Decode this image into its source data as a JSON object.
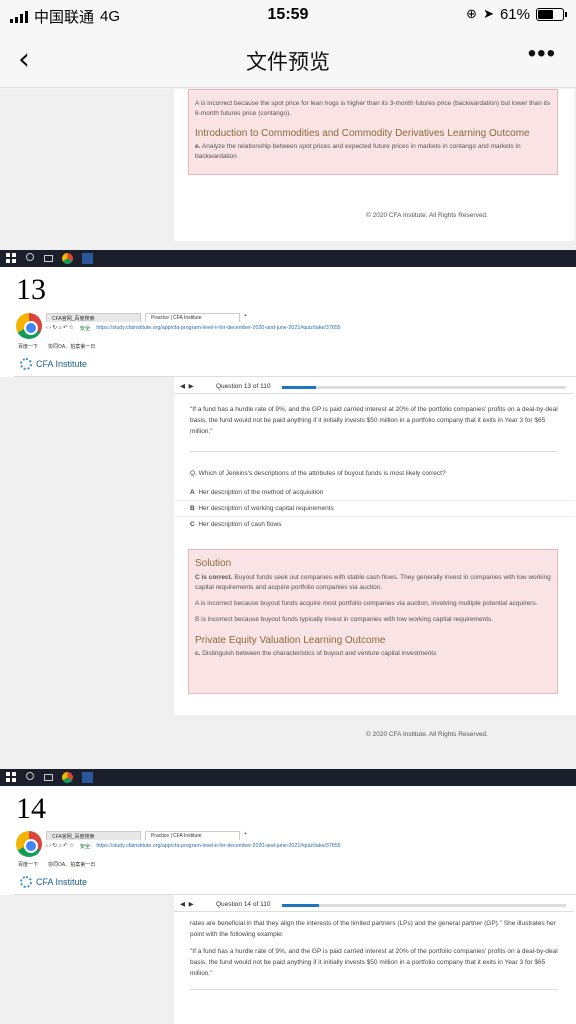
{
  "status": {
    "carrier": "中国联通",
    "network": "4G",
    "time": "15:59",
    "battery": "61%",
    "battery_level": 0.61
  },
  "nav": {
    "back_icon": "chevron-left",
    "title": "文件预览",
    "more_icon": "more-dots"
  },
  "prev_page": {
    "explanation_a": "A is incorrect because the spot price for lean hogs is higher than its 3-month futures price (backwardation) but lower than its 6-month futures price (contango).",
    "outcome_title": "Introduction to Commodities and Commodity Derivatives Learning Outcome",
    "outcome_letter": "e.",
    "outcome_text": "Analyze the relationship between spot prices and expected future prices in markets in contango and markets in backwardation",
    "footer": "© 2020 CFA Institute. All Rights Reserved."
  },
  "page13": {
    "number": "13",
    "tab1": "CFA官网_百度搜索",
    "tab2": "Practice | CFA Institute",
    "secure": "安全",
    "url": "https://study.cfainstitute.org/app/cfa-program-level-ii-for-december-2020-and-june-2021#quiz/take/37655",
    "bookmark1": "百度一下",
    "bookmark2": "协同OA、拍案第一日",
    "brand": "CFA Institute",
    "question_label": "Question 13 of 110",
    "progress": 0.12,
    "quote": "\"If a fund has a hurdle rate of 9%, and the GP is paid carried interest at 20% of the portfolio companies' profits on a deal-by-deal basis, the fund would not be paid anything if it initially invests $50 million in a portfolio company that it exits in Year 3 for $65 million.\"",
    "question": "Q. Which of Jenkins's descriptions of the attributes of buyout funds is most likely correct?",
    "options": [
      {
        "letter": "A",
        "text": "Her description of the method of acquisition"
      },
      {
        "letter": "B",
        "text": "Her description of working capital requirements"
      },
      {
        "letter": "C",
        "text": "Her description of cash flows"
      }
    ],
    "solution_title": "Solution",
    "solution_correct": "C is correct.",
    "solution_text": "Buyout funds seek out companies with stable cash flows. They generally invest in companies with low working capital requirements and acquire portfolio companies via auction.",
    "explanation_a": "A is incorrect because buyout funds acquire most portfolio companies via auction, involving multiple potential acquirers.",
    "explanation_b": "B is incorrect because buyout funds typically invest in companies with low working capital requirements.",
    "outcome_title": "Private Equity Valuation Learning Outcome",
    "outcome_letter": "c.",
    "outcome_text": "Distinguish between the characteristics of buyout and venture capital investments",
    "footer": "© 2020 CFA Institute. All Rights Reserved."
  },
  "page14": {
    "number": "14",
    "tab1": "CFA官网_百度搜索",
    "tab2": "Practice | CFA Institute",
    "secure": "安全",
    "url": "https://study.cfainstitute.org/app/cfa-program-level-ii-for-december-2020-and-june-2021#quiz/take/37655",
    "bookmark1": "百度一下",
    "bookmark2": "协同OA、拍案第一日",
    "brand": "CFA Institute",
    "question_label": "Question 14 of 110",
    "progress": 0.13,
    "text1": "rates are beneficial in that they align the interests of the limited partners (LPs) and the general partner (GP).\" She illustrates her point with the following example:",
    "quote": "\"If a fund has a hurdle rate of 9%, and the GP is paid carried interest at 20% of the portfolio companies' profits on a deal-by-deal basis, the fund would not be paid anything if it initially invests $50 million in a portfolio company that it exits in Year 3 for $65 million.\""
  }
}
